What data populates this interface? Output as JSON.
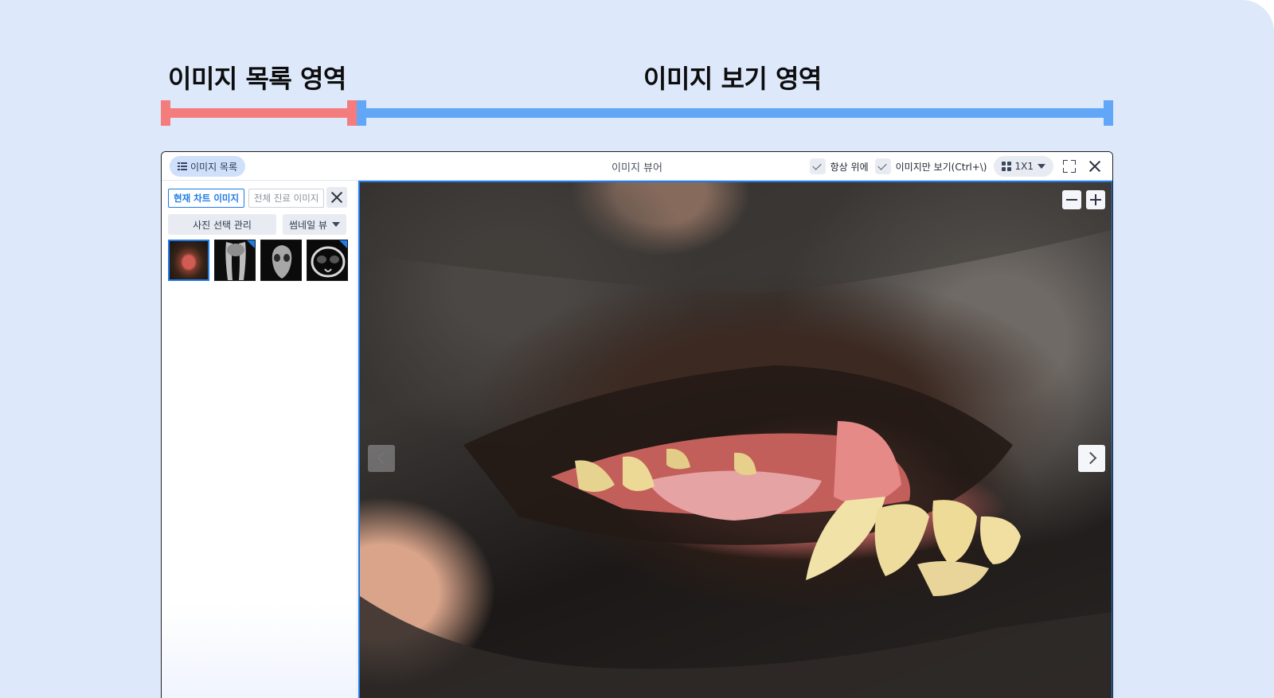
{
  "annotations": {
    "list_area_label": "이미지 목록 영역",
    "view_area_label": "이미지 보기 영역",
    "list_area_color": "#f47c7c",
    "view_area_color": "#62a6f7"
  },
  "window": {
    "title": "이미지 뷰어",
    "list_toggle_label": "이미지 목록",
    "always_on_top_label": "항상 위에",
    "image_only_label": "이미지만 보기(Ctrl+\\)",
    "layout_value": "1X1"
  },
  "sidebar": {
    "tab_current": "현재 차트 이미지",
    "tab_all": "전체 진료 이미지",
    "manage_button": "사진 선택 관리",
    "view_mode": "썸네일 뷰",
    "thumbnails": [
      {
        "name": "dental-photo",
        "selected": true
      },
      {
        "name": "pelvis-xray",
        "selected": false
      },
      {
        "name": "skull-xray",
        "selected": false
      },
      {
        "name": "skull-ct",
        "selected": false
      }
    ]
  },
  "viewer": {
    "image_subject": "dog-mouth-dental-photo"
  },
  "colors": {
    "accent": "#1e7be8",
    "background": "#dde8fb"
  }
}
